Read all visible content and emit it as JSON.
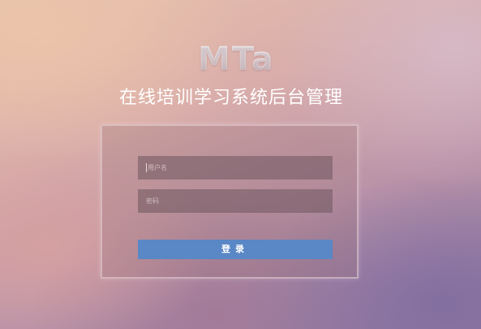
{
  "logo": {
    "text": "MTa"
  },
  "header": {
    "title": "在线培训学习系统后台管理"
  },
  "login_form": {
    "username_placeholder": "用户名",
    "password_placeholder": "密码",
    "login_label": "登录"
  },
  "colors": {
    "button_background": "#5a87c5",
    "title_text": "#ffffff"
  }
}
